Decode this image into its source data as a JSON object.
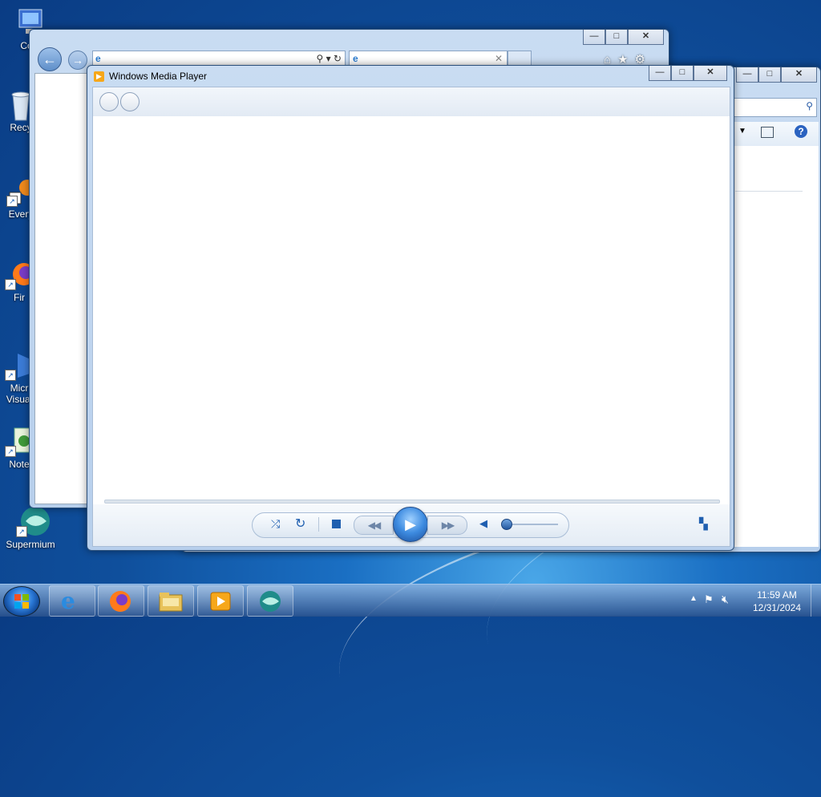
{
  "desktop": {
    "icons": [
      {
        "label": "Com",
        "icon": "computer-icon"
      },
      {
        "label": "Recy",
        "icon": "recycle-bin-icon"
      },
      {
        "label": "Every",
        "icon": "everything-search-icon"
      },
      {
        "label": "Fir",
        "icon": "firefox-icon"
      },
      {
        "label": "Micr",
        "label2": "Visual",
        "icon": "visual-studio-icon"
      },
      {
        "label": "Note",
        "icon": "notepad-icon"
      },
      {
        "label": "Supermium",
        "icon": "supermium-icon"
      }
    ]
  },
  "ie_window": {
    "tab_title": "",
    "address": ""
  },
  "explorer_window": {
    "search_placeholder": ""
  },
  "wmp": {
    "title": "Windows Media Player",
    "controls": {
      "shuffle": "shuffle-icon",
      "repeat": "repeat-icon",
      "stop": "stop-icon",
      "previous": "previous-icon",
      "play": "play-icon",
      "next": "next-icon",
      "mute": "volume-icon",
      "switch_view": "switch-to-library-icon"
    },
    "volume_level": 0.05,
    "seek_position": 0
  },
  "taskbar": {
    "apps": [
      "Internet Explorer",
      "Firefox",
      "Windows Explorer",
      "Windows Media Player",
      "Supermium"
    ],
    "time": "11:59 AM",
    "date": "12/31/2024"
  }
}
